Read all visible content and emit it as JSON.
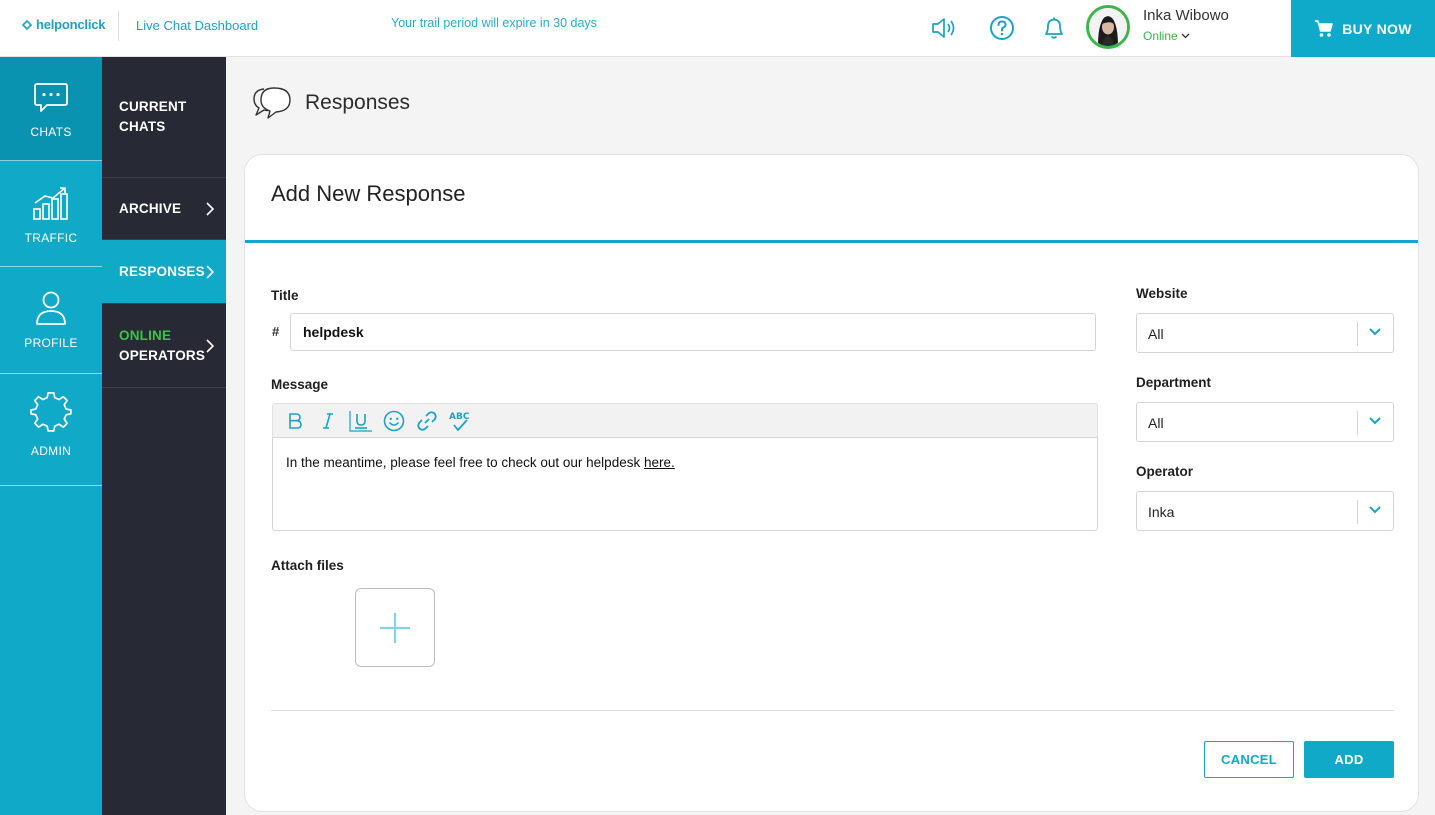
{
  "topbar": {
    "logo_text": "helponclick",
    "dashboard_title": "Live Chat Dashboard",
    "trial_notice": "Your trail period will expire in 30 days",
    "user_name": "Inka Wibowo",
    "user_status": "Online",
    "buy_now_label": "BUY NOW"
  },
  "rail": {
    "items": [
      {
        "label": "CHATS",
        "icon": "chat-bubble-icon"
      },
      {
        "label": "TRAFFIC",
        "icon": "bar-chart-icon"
      },
      {
        "label": "PROFILE",
        "icon": "user-icon"
      },
      {
        "label": "ADMIN",
        "icon": "gear-icon"
      }
    ]
  },
  "subnav": {
    "current_chats": "CURRENT CHATS",
    "archive": "ARCHIVE",
    "responses": "RESPONSES",
    "online": "ONLINE",
    "operators": "OPERATORS"
  },
  "page": {
    "title": "Responses"
  },
  "form": {
    "card_title": "Add New Response",
    "title_label": "Title",
    "title_prefix": "#",
    "title_value": "helpdesk",
    "message_label": "Message",
    "message_text": "In the meantime, please feel free to check out our helpdesk",
    "message_link": "here.",
    "attach_label": "Attach files",
    "website_label": "Website",
    "website_value": "All",
    "department_label": "Department",
    "department_value": "All",
    "operator_label": "Operator",
    "operator_value": "Inka",
    "cancel_label": "CANCEL",
    "add_label": "ADD"
  },
  "colors": {
    "accent": "#10a9c8",
    "sidebar_dark": "#272a34",
    "online_green": "#3cb54a"
  }
}
